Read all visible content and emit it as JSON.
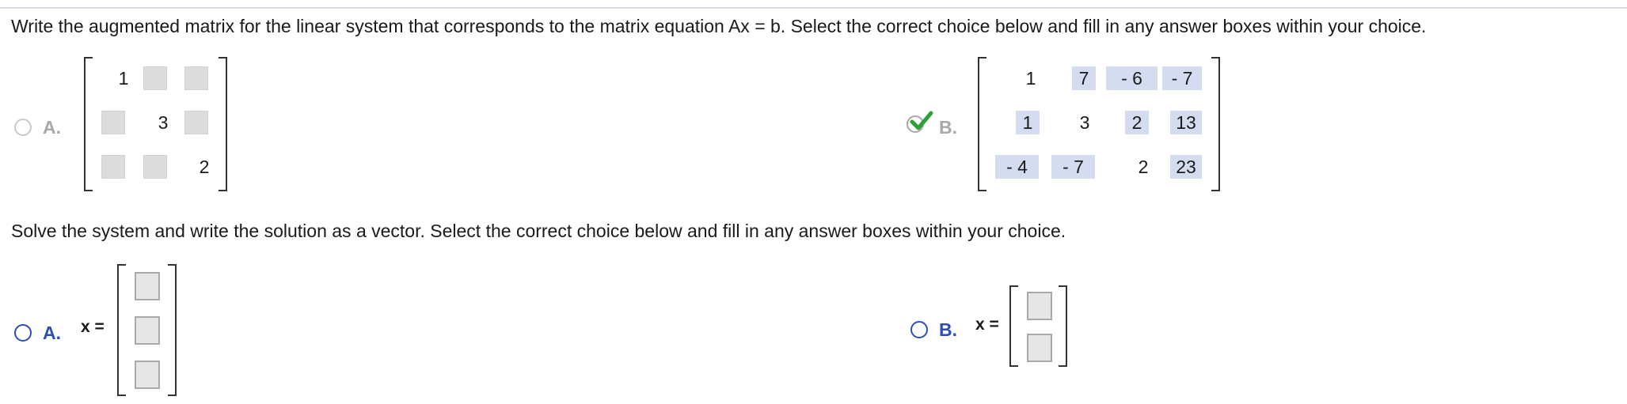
{
  "prompts": {
    "part1": "Write the augmented matrix for the linear system that corresponds to the matrix equation Ax = b. Select the correct choice below and fill in any answer boxes within your choice.",
    "part2": "Solve the system and write the solution as a vector. Select the correct choice below and fill in any answer boxes within your choice."
  },
  "part1": {
    "choiceA": {
      "letter": "A.",
      "diagonal": [
        "1",
        "3",
        "2"
      ]
    },
    "choiceB": {
      "letter": "B.",
      "status": "correct, selected",
      "rows": [
        [
          "1",
          "7",
          "- 6",
          "- 7"
        ],
        [
          "1",
          "3",
          "2",
          "13"
        ],
        [
          "- 4",
          "- 7",
          "2",
          "23"
        ]
      ]
    }
  },
  "part2": {
    "choiceA": {
      "letter": "A.",
      "label": "x ="
    },
    "choiceB": {
      "letter": "B.",
      "label": "x ="
    }
  },
  "colors": {
    "accent": "#2d4fb4",
    "check": "#2ea03a",
    "filled_box": "#d4ddef",
    "empty_box": "#dcdcdc"
  }
}
